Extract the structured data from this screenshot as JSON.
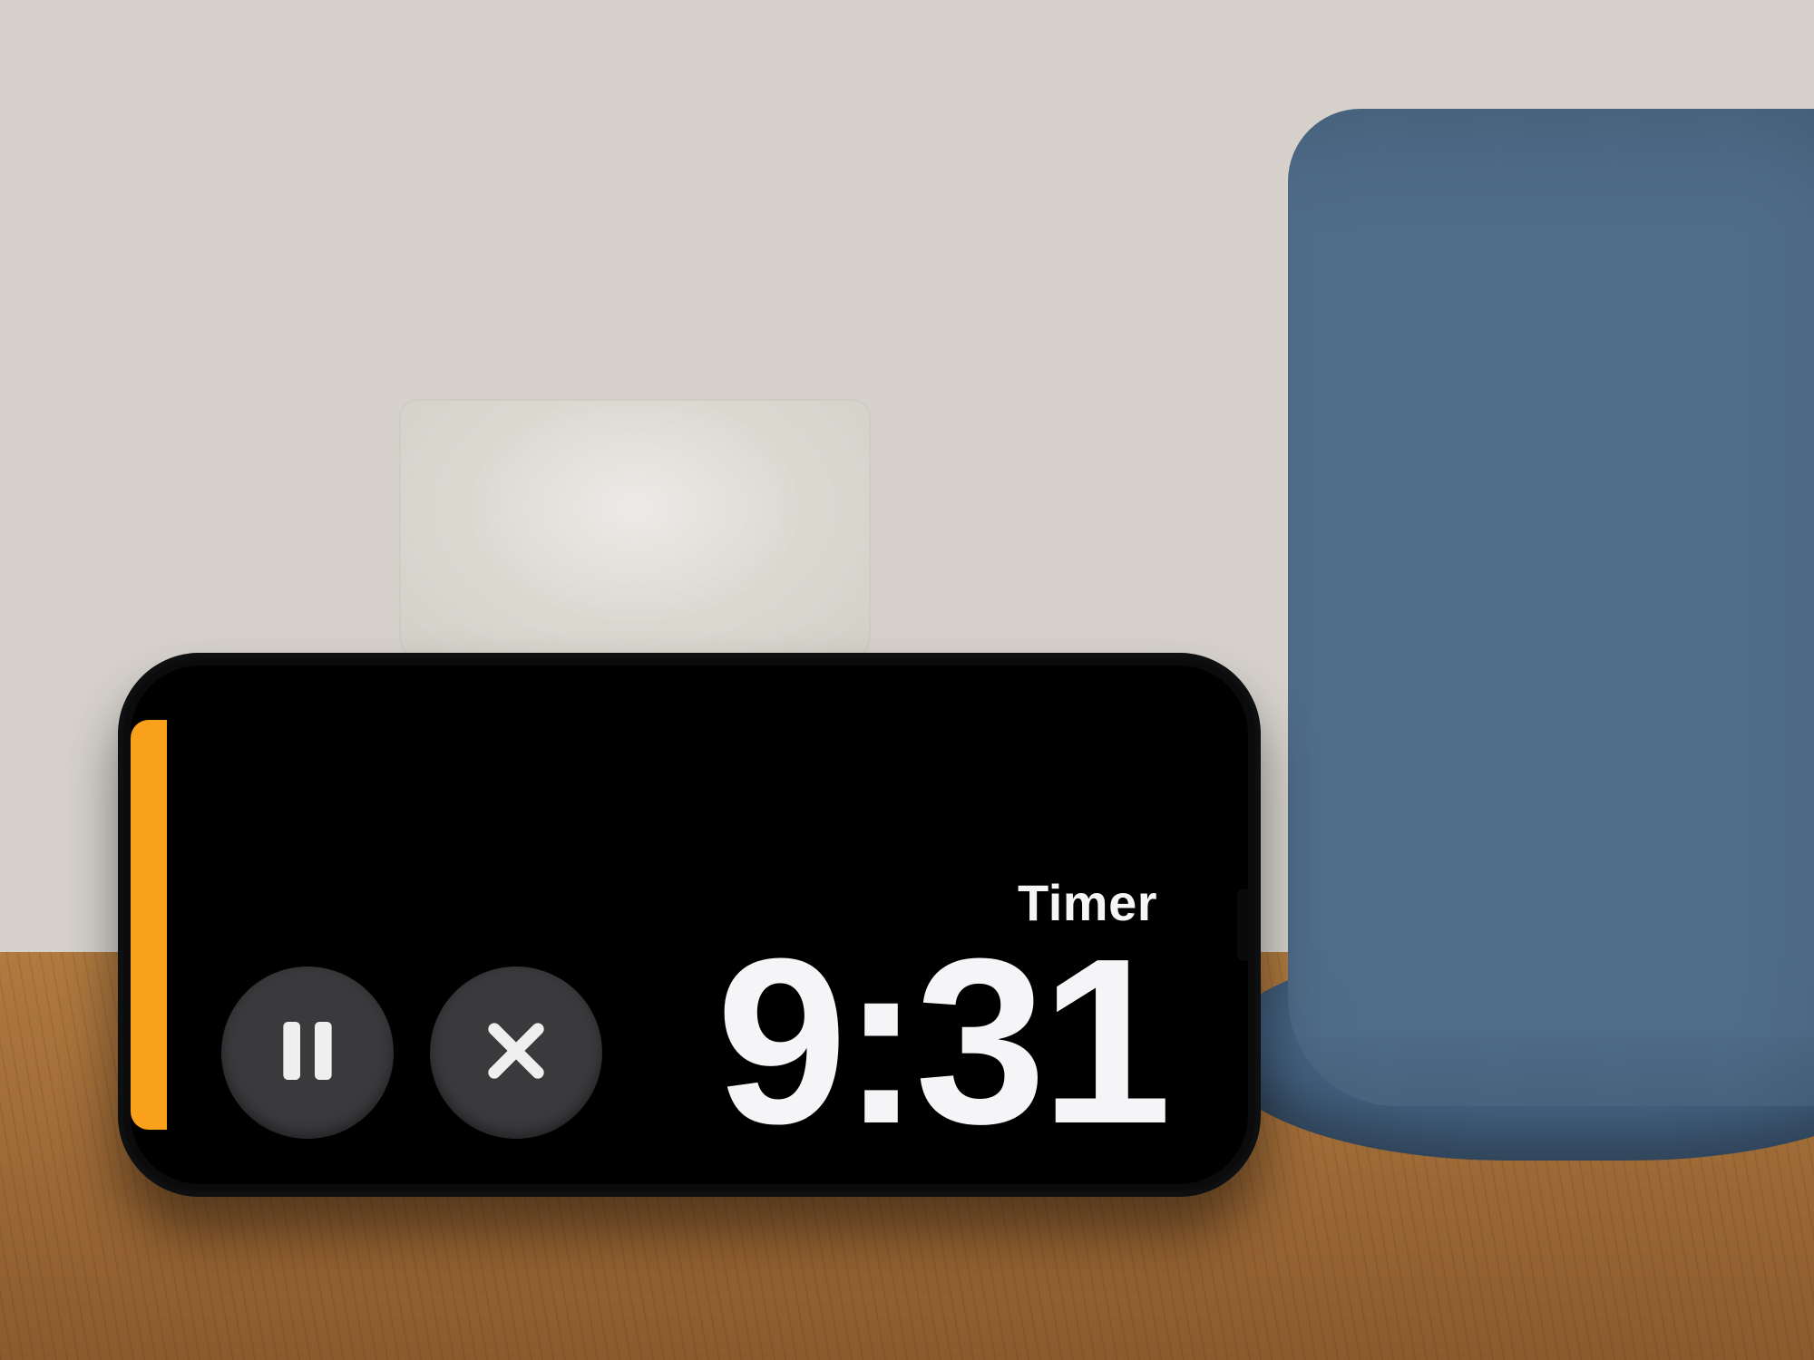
{
  "timer": {
    "label": "Timer",
    "time": "9:31"
  },
  "controls": {
    "pause": "pause",
    "cancel": "cancel"
  },
  "colors": {
    "accent": "#f9a11b",
    "button_bg": "#3a3a3d",
    "text": "#f5f5f7"
  }
}
